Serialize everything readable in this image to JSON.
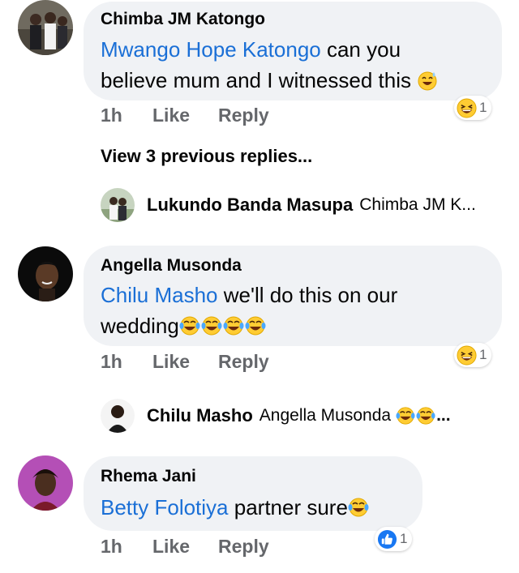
{
  "comments": [
    {
      "author": "Chimba JM Katongo",
      "mention": "Mwango Hope Katongo",
      "text_line1": " can you",
      "text_line2": "believe mum and I witnessed this",
      "time": "1h",
      "like_label": "Like",
      "reply_label": "Reply",
      "reaction_count": "1",
      "reaction_icon": "laughing-emoji-icon"
    },
    {
      "author": "Angella Musonda",
      "mention": "Chilu Masho",
      "text_line1": " we'll do this on our",
      "text_line2": "wedding",
      "time": "1h",
      "like_label": "Like",
      "reply_label": "Reply",
      "reaction_count": "1",
      "reaction_icon": "laughing-emoji-icon"
    },
    {
      "author": "Rhema Jani",
      "mention": "Betty Folotiya",
      "text_line1": " partner sure",
      "time": "1h",
      "like_label": "Like",
      "reply_label": "Reply",
      "reaction_count": "1",
      "reaction_icon": "like-thumb-icon"
    }
  ],
  "view_previous": "View 3 previous replies...",
  "replies": [
    {
      "name": "Lukundo Banda Masupa",
      "preview": "Chimba JM K..."
    },
    {
      "name": "Chilu Masho",
      "preview": "Angella Musonda",
      "preview_suffix": "..."
    }
  ],
  "colors": {
    "bubble": "#f0f2f5",
    "mention": "#1a6fd6",
    "meta": "#65676b",
    "like_blue": "#1877f2"
  }
}
